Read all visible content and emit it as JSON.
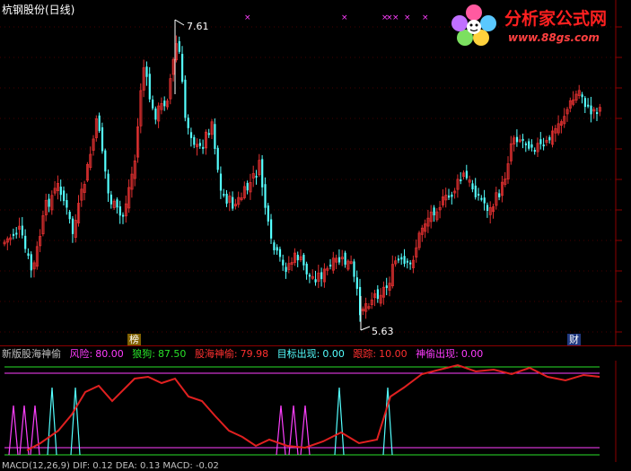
{
  "window": {
    "title": "杭钢股份(日线)"
  },
  "watermark": {
    "name": "分析家公式网",
    "url": "www.88gs.com"
  },
  "price_panel": {
    "high_label": "7.61",
    "low_label": "5.63",
    "badge_bang": "榜",
    "badge_cai": "财",
    "colors": {
      "up": "#e03030",
      "down": "#54ffff",
      "grid": "#8b0000",
      "marker": "#ff40ff"
    }
  },
  "indicator": {
    "name": "新版股海神偷",
    "fields": [
      {
        "label": "风险:",
        "value": "80.00",
        "color": "#ff3cff"
      },
      {
        "label": "狼狗:",
        "value": "87.50",
        "color": "#28e028"
      },
      {
        "label": "股海神偷:",
        "value": "79.98",
        "color": "#ff3030"
      },
      {
        "label": "目标出现:",
        "value": "0.00",
        "color": "#54ffff"
      },
      {
        "label": "跟踪:",
        "value": "10.00",
        "color": "#ff3030"
      },
      {
        "label": "神偷出现:",
        "value": "0.00",
        "color": "#ff3cff"
      }
    ]
  },
  "macd": {
    "text": "MACD(12,26,9) DIF: 0.12 DEA: 0.13 MACD: -0.02"
  }
}
